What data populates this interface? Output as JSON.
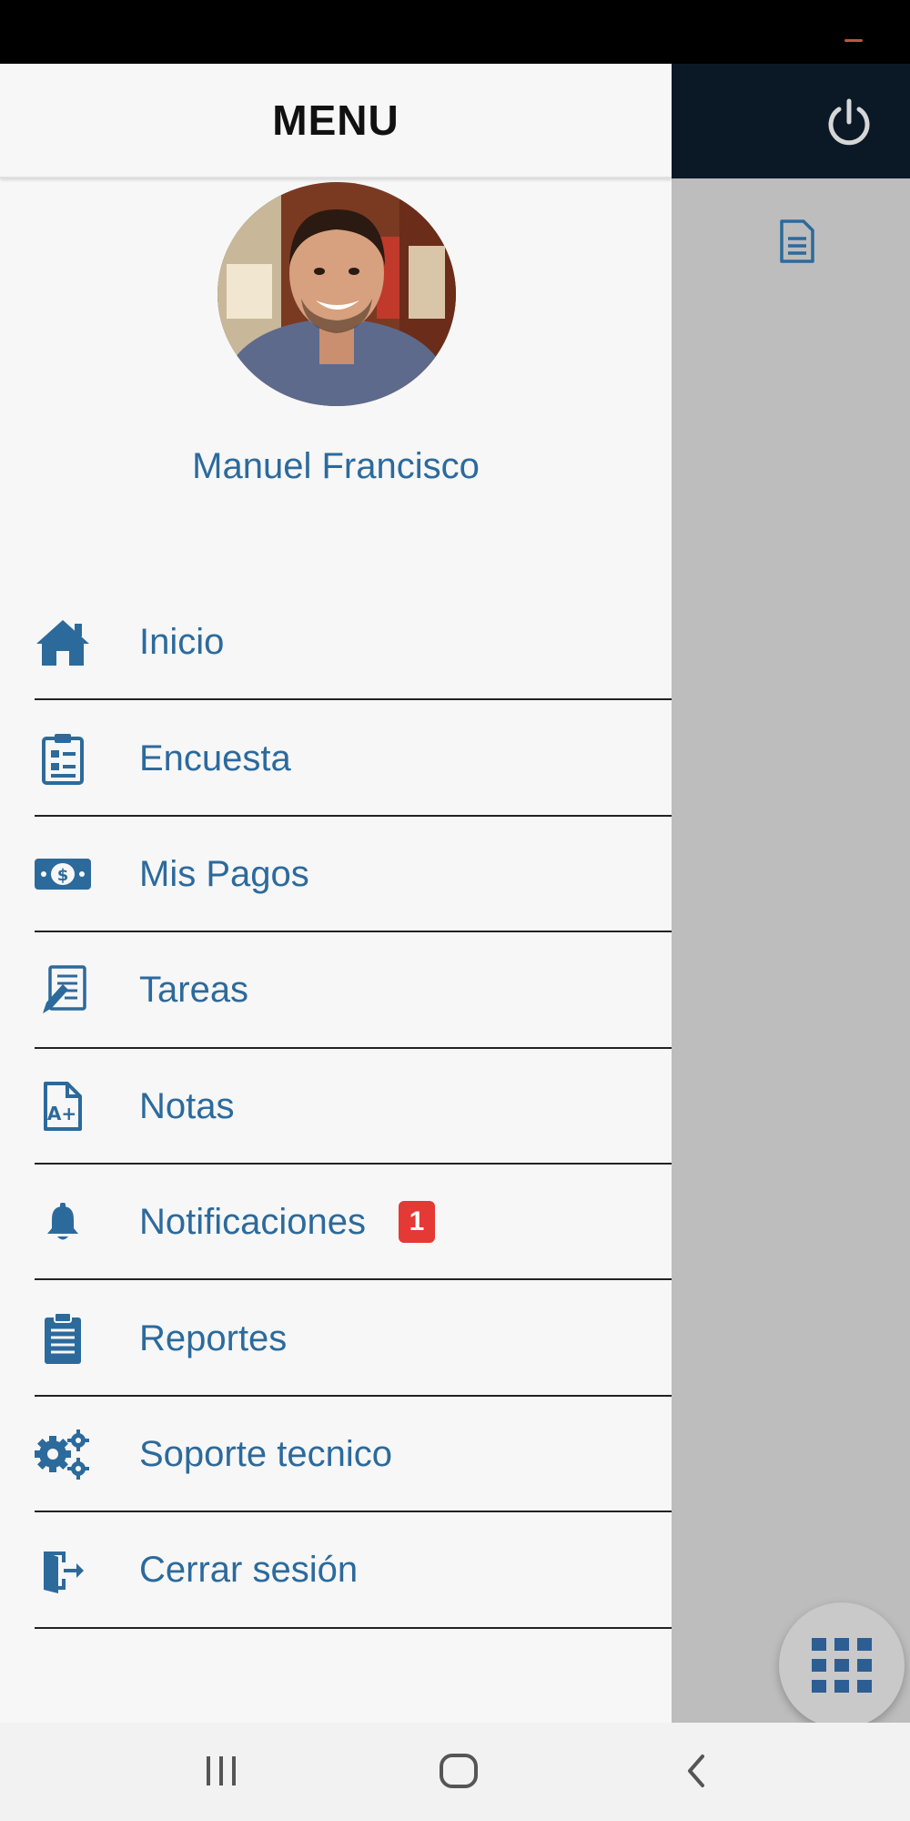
{
  "drawer": {
    "title": "MENU",
    "user_name": "Manuel Francisco",
    "items": [
      {
        "label": "Inicio",
        "icon": "home-icon"
      },
      {
        "label": "Encuesta",
        "icon": "survey-clipboard-icon"
      },
      {
        "label": "Mis Pagos",
        "icon": "money-bill-icon"
      },
      {
        "label": "Tareas",
        "icon": "task-pencil-icon"
      },
      {
        "label": "Notas",
        "icon": "grade-document-icon"
      },
      {
        "label": "Notificaciones",
        "icon": "bell-icon",
        "badge": "1"
      },
      {
        "label": "Reportes",
        "icon": "report-clipboard-icon"
      },
      {
        "label": "Soporte tecnico",
        "icon": "gears-icon"
      },
      {
        "label": "Cerrar sesión",
        "icon": "sign-out-icon"
      }
    ]
  },
  "colors": {
    "accent": "#2c6a9c",
    "header_dark": "#0b1927",
    "badge": "#e53935",
    "overlay": "#bdbdbd"
  }
}
